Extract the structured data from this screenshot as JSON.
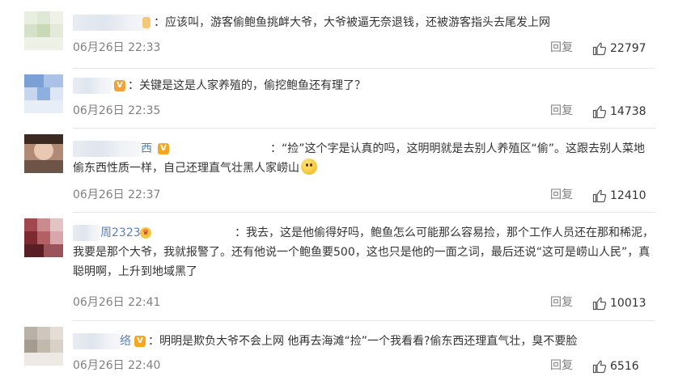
{
  "comments": [
    {
      "name_tail": "",
      "badge": "",
      "prefix": "：",
      "text": "应该叫，游客偷鲍鱼挑衅大爷，大爷被逼无奈退钱，还被游客指头去尾发上网",
      "time": "06月26日 22:33",
      "reply": "回复",
      "likes": "22797"
    },
    {
      "name_tail": "",
      "badge": "V",
      "prefix": "：",
      "text": "关键是这是人家养殖的，偷挖鲍鱼还有理了？",
      "time": "06月26日 22:35",
      "reply": "回复",
      "likes": "14738"
    },
    {
      "name_tail": "西",
      "badge": "V",
      "prefix": "：",
      "text": "“捡”这个字是认真的吗，这明明就是去别人养殖区“偷”。这跟去别人菜地偷东西性质一样，自己还理直气壮黑人家崂山",
      "time": "06月26日 22:37",
      "reply": "回复",
      "likes": "12410"
    },
    {
      "name_tail": "周2323",
      "badge": "♛",
      "prefix": "：",
      "text": "我去，这是他偷得好吗，鲍鱼怎么可能那么容易捡，那个工作人员还在那和稀泥，我要是那个大爷，我就报警了。还有他说一个鲍鱼要500，这也只是他的一面之词，最后还说“这可是崂山人民”，真聪明啊，上升到地域黑了",
      "time": "06月26日 22:41",
      "reply": "回复",
      "likes": "10013"
    },
    {
      "name_tail": "络",
      "badge": "V",
      "prefix": "：",
      "text": "明明是欺负大爷不会上网 他再去海滩“捡”一个我看看?偷东西还理直气壮，臭不要脸",
      "time": "06月26日 22:40",
      "reply": "回复",
      "likes": "6516"
    }
  ],
  "colors": {
    "text": "#333333",
    "meta": "#808080",
    "name": "#eb7350",
    "divider": "#e6e6e6"
  },
  "icons": {
    "like": "thumbs-up-icon",
    "verified": "verified-badge-icon",
    "emoji": "smiley-emoji-icon"
  }
}
